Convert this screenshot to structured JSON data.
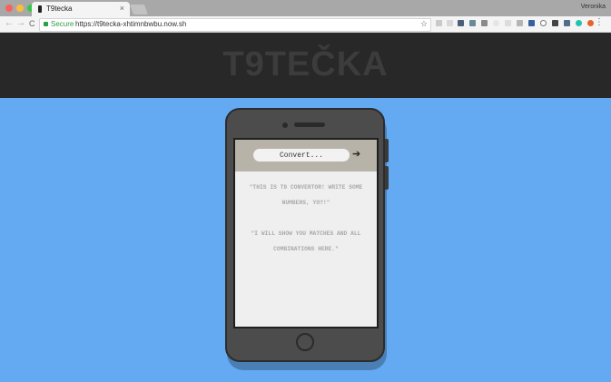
{
  "browser": {
    "tab_title": "T9tecka",
    "tab_close": "×",
    "profile_name": "Veronika",
    "back": "←",
    "forward": "→",
    "reload": "C",
    "secure_label": "Secure",
    "url": "https://t9tecka-xhtimnbwbu.now.sh",
    "bookmark_star": "☆",
    "menu_dots": "⋮"
  },
  "header": {
    "logo": "T9TEČKA"
  },
  "converter": {
    "placeholder": "Convert...",
    "submit_icon": "➔"
  },
  "messages": {
    "intro": "\"THIS IS T9 CONVERTOR! WRITE SOME NUMBERS, YO?!\"",
    "hint": "\"I WILL SHOW YOU MATCHES AND ALL COMBINATIONS HERE.\""
  },
  "colors": {
    "page_background": "#64aaf2",
    "header_background": "#282828",
    "logo_color": "#3c3c3c",
    "phone_body": "#4c4c4c",
    "screen_bar": "#b8b3a9"
  }
}
